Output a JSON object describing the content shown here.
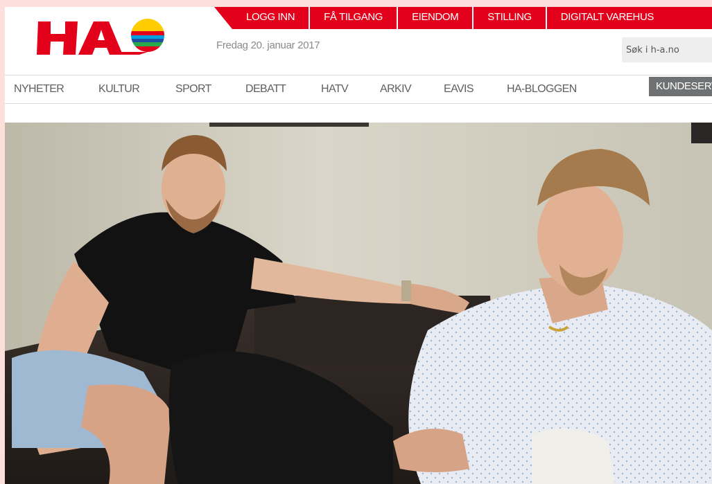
{
  "site": {
    "logo_text": "HA",
    "date": "Fredag 20. januar 2017"
  },
  "topbar": {
    "items": [
      {
        "label": "LOGG INN"
      },
      {
        "label": "FÅ TILGANG"
      },
      {
        "label": "EIENDOM"
      },
      {
        "label": "STILLING"
      },
      {
        "label": "DIGITALT VAREHUS"
      }
    ]
  },
  "search": {
    "placeholder": "Søk i h-a.no"
  },
  "nav": {
    "items": [
      {
        "label": "NYHETER"
      },
      {
        "label": "KULTUR"
      },
      {
        "label": "SPORT"
      },
      {
        "label": "DEBATT"
      },
      {
        "label": "HATV"
      },
      {
        "label": "ARKIV"
      },
      {
        "label": "EAVIS"
      },
      {
        "label": "HA-BLOGGEN"
      }
    ],
    "customer_service_label": "KUNDESERVICE"
  },
  "colors": {
    "brand_red": "#e3001b",
    "nav_gray": "#606060",
    "button_gray": "#6f7172"
  },
  "icons": {
    "logo_sun": "striped-sun-logo-icon"
  }
}
